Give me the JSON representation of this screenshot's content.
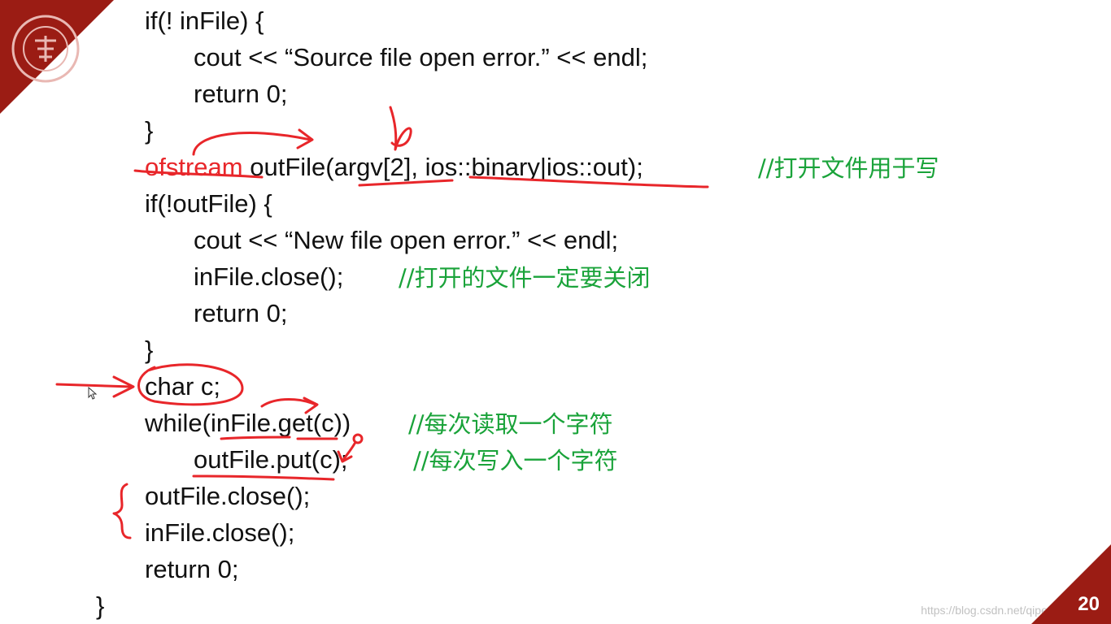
{
  "slide": {
    "page_number": "20",
    "watermark": "https://blog.csdn.net/qipeng_master",
    "colors": {
      "accent": "#9b1c14",
      "comment": "#1aa33a",
      "ink": "#e8262a",
      "code": "#111111"
    }
  },
  "code": {
    "line1": "if(! inFile) {",
    "line2": "cout << “Source file open error.” << endl;",
    "line3": "return 0;",
    "line4": "}",
    "line5_kw": "ofstream",
    "line5_rest": " outFile(argv[2], ios::binary|ios::out);",
    "line5_comment": "//打开文件用于写",
    "line6": "if(!outFile) {",
    "line7": "cout << “New file open error.” << endl;",
    "line8": "inFile.close();",
    "line8_comment": "//打开的文件一定要关闭",
    "line9": "return 0;",
    "line10": "}",
    "line11": "char c;",
    "line12": "while(inFile.get(c))",
    "line12_comment": "//每次读取一个字符",
    "line13": "outFile.put(c);",
    "line13_comment": "//每次写入一个字符",
    "line14": "outFile.close();",
    "line15": "inFile.close();",
    "line16": "return 0;",
    "line17": "}"
  },
  "icons": {
    "seal": "university-seal-icon",
    "cursor": "mouse-pointer-icon"
  }
}
